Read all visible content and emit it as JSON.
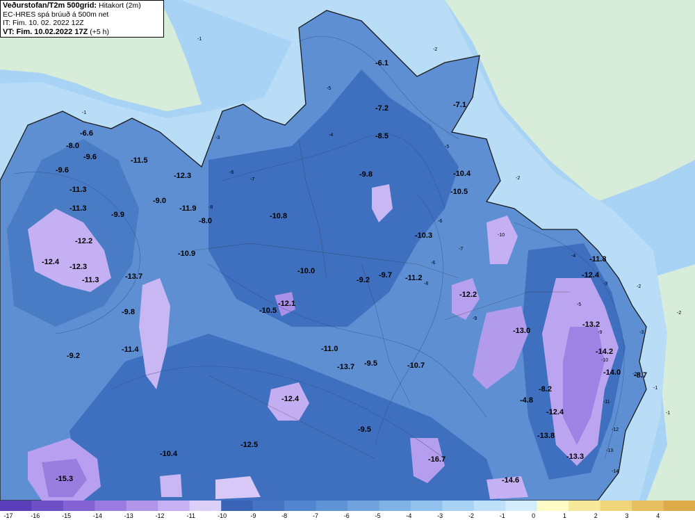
{
  "header": {
    "title_bold": "Veðurstofan/T2m 500grid:",
    "title_rest": "Hitakort (2m)",
    "line2": "EC-HRES spá brúuð á 500m net",
    "line3": "IT: Fim. 10. 02. 2022 12Z",
    "line4_bold": "VT: Fim. 10.02.2022 17Z",
    "line4_rest": "(+5 h)"
  },
  "labels": [
    "-6.6",
    "-8.0",
    "-9.6",
    "-9.6",
    "-11.3",
    "-11.3",
    "-9.9",
    "-12.2",
    "-12.4",
    "-12.3",
    "-11.3",
    "-13.7",
    "-9.8",
    "-9.2",
    "-11.4",
    "-11.5",
    "-12.3",
    "-9.0",
    "-11.9",
    "-8.0",
    "-10.9",
    "-6.1",
    "-7.2",
    "-7.1",
    "-8.5",
    "-9.8",
    "-10.4",
    "-10.5",
    "-10.8",
    "-10.3",
    "-10.0",
    "-9.2",
    "-9.7",
    "-11.2",
    "-12.1",
    "-10.5",
    "-12.2",
    "-13.0",
    "-11.0",
    "-13.7",
    "-9.5",
    "-10.7",
    "-12.4",
    "-11.8",
    "-12.4",
    "-13.2",
    "-14.2",
    "-14.0",
    "-8.7",
    "-8.2",
    "-4.8",
    "-12.4",
    "-13.8",
    "-13.3",
    "-9.5",
    "-12.5",
    "-10.4",
    "-16.7",
    "-14.6",
    "-15.3"
  ],
  "contour_labels": [
    "-1",
    "-1",
    "-2",
    "-2",
    "-2",
    "-2",
    "-1",
    "-4",
    "-5",
    "-3",
    "-6",
    "-7",
    "-8",
    "-5",
    "-6",
    "-6",
    "-7",
    "-8",
    "-9",
    "-10",
    "-3",
    "-4",
    "-5",
    "-9",
    "-10",
    "-11",
    "-12",
    "-13",
    "-14",
    "-2",
    "-1",
    "-3"
  ],
  "legend": {
    "ticks": [
      "-17",
      "-16",
      "-15",
      "-14",
      "-13",
      "-12",
      "-11",
      "-10",
      "-9",
      "-8",
      "-7",
      "-6",
      "-5",
      "-4",
      "-3",
      "-2",
      "-1",
      "0",
      "1",
      "2",
      "3",
      "4"
    ],
    "colors": [
      "#5a3db8",
      "#6d4fc6",
      "#8363d3",
      "#9a7bdf",
      "#b195e9",
      "#c8b1f2",
      "#ddd0f8",
      "#3a64b8",
      "#4575c2",
      "#5285cd",
      "#6094d6",
      "#70a3de",
      "#81b2e6",
      "#93c1ed",
      "#a9d3f5",
      "#bee0f8",
      "#d4ecfb",
      "#fffbc4",
      "#f6e99a",
      "#eed57a",
      "#e6c060",
      "#ddaa4a"
    ]
  }
}
